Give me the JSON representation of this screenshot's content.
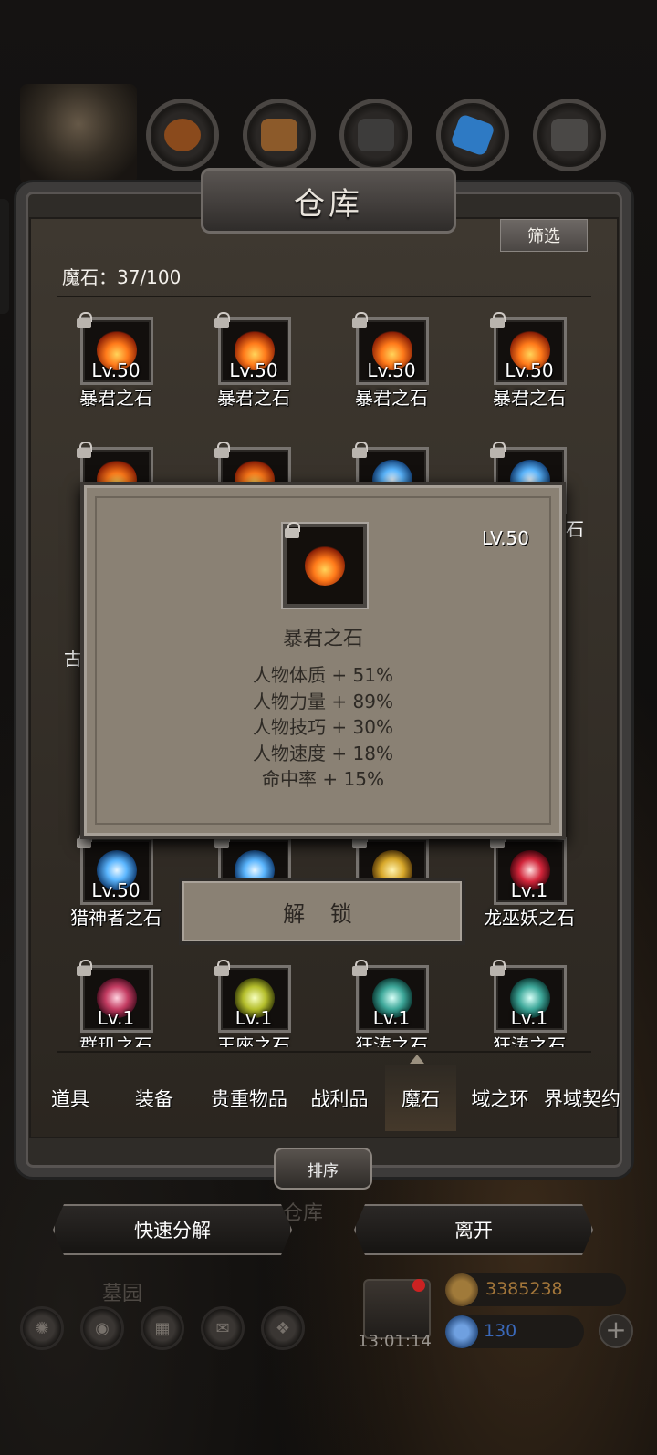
{
  "warehouse": {
    "title": "仓库",
    "filter_label": "筛选",
    "count_label": "魔石：37/100"
  },
  "grid": {
    "rows": [
      [
        {
          "name": "暴君之石",
          "level": "Lv.50",
          "gem": "fire-gem"
        },
        {
          "name": "暴君之石",
          "level": "Lv.50",
          "gem": "fire-gem"
        },
        {
          "name": "暴君之石",
          "level": "Lv.50",
          "gem": "fire-gem"
        },
        {
          "name": "暴君之石",
          "level": "Lv.50",
          "gem": "fire-gem"
        }
      ],
      [
        {
          "name": "猎神者之石",
          "level": "Lv.50",
          "gem": "frost-gem"
        },
        {
          "name": "",
          "level": "",
          "gem": "frost-gem"
        },
        {
          "name": "",
          "level": "",
          "gem": "gold-gem"
        },
        {
          "name": "龙巫妖之石",
          "level": "Lv.1",
          "gem": "blood-gem"
        }
      ],
      [
        {
          "name": "群玑之石",
          "level": "Lv.1",
          "gem": "pink-gem"
        },
        {
          "name": "王座之石",
          "level": "Lv.1",
          "gem": "lime-gem"
        },
        {
          "name": "狂涛之石",
          "level": "Lv.1",
          "gem": "teal-gem"
        },
        {
          "name": "狂涛之石",
          "level": "Lv.1",
          "gem": "teal-gem"
        }
      ]
    ],
    "partial_labels": {
      "left": "古",
      "right": "石"
    }
  },
  "popup": {
    "level": "LV.50",
    "name": "暴君之石",
    "stats": [
      "人物体质 + 51%",
      "人物力量 + 89%",
      "人物技巧 + 30%",
      "人物速度 + 18%",
      "命中率 + 15%"
    ],
    "unlock_label": "解 锁"
  },
  "tabs": [
    {
      "label": "道具"
    },
    {
      "label": "装备"
    },
    {
      "label": "贵重物品"
    },
    {
      "label": "战利品"
    },
    {
      "label": "魔石",
      "active": true
    },
    {
      "label": "域之环"
    },
    {
      "label": "界域契约"
    }
  ],
  "sort_label": "排序",
  "bottom": {
    "decompose_label": "快速分解",
    "leave_label": "离开",
    "ghost_warehouse": "仓库",
    "ghost_graveyard": "墓园"
  },
  "hud": {
    "timer": "13:01:14",
    "gold": "3385238",
    "gems": "130"
  },
  "colors": {
    "gold_text": "#a3763a",
    "gem_text": "#3a68b8"
  }
}
